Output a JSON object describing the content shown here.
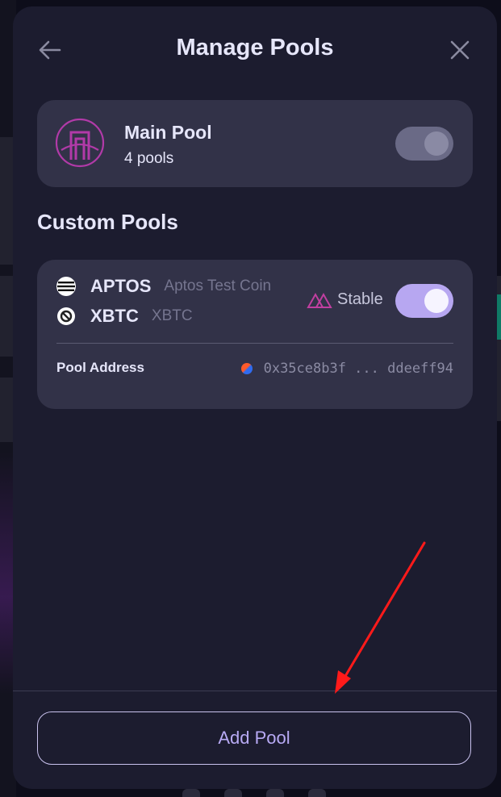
{
  "modal": {
    "title": "Manage Pools",
    "back_icon": "arrow-left-icon",
    "close_icon": "close-icon"
  },
  "main_pool": {
    "name": "Main Pool",
    "count_label": "4 pools",
    "logo_icon": "bridge-logo-icon",
    "enabled": false
  },
  "custom_pools": {
    "section_title": "Custom Pools",
    "items": [
      {
        "coins": [
          {
            "symbol": "APTOS",
            "name": "Aptos Test Coin",
            "icon": "aptos-icon"
          },
          {
            "symbol": "XBTC",
            "name": "XBTC",
            "icon": "xbtc-icon"
          }
        ],
        "curve_label": "Stable",
        "curve_icon": "stable-curve-icon",
        "enabled": true,
        "address_label": "Pool Address",
        "address_value": "0x35ce8b3f ... ddeeff94"
      }
    ]
  },
  "footer": {
    "add_pool_label": "Add Pool"
  },
  "annotation": {
    "color": "#ff1a1a",
    "icon": "red-arrow-annotation"
  },
  "colors": {
    "modal_bg": "#1c1c2f",
    "card_bg": "#323248",
    "accent": "#b7a7f1",
    "text_primary": "#e6e6fa"
  }
}
